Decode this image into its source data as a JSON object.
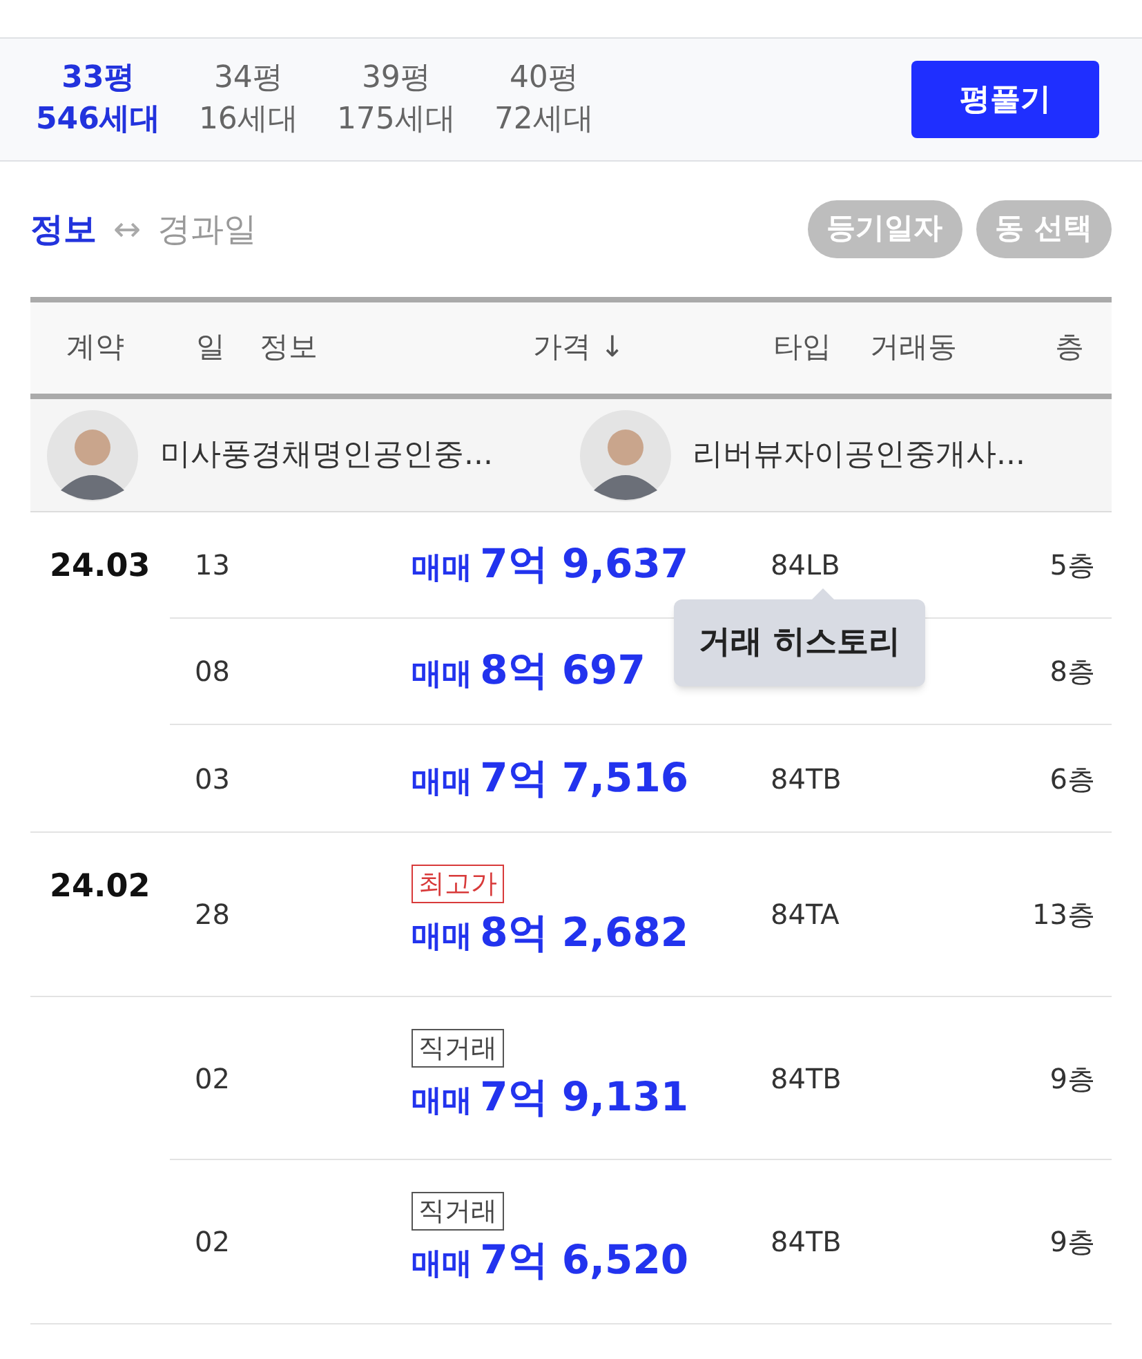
{
  "size_tabs": [
    {
      "area": "33평",
      "households": "546세대",
      "selected": true
    },
    {
      "area": "34평",
      "households": "16세대",
      "selected": false
    },
    {
      "area": "39평",
      "households": "175세대",
      "selected": false
    },
    {
      "area": "40평",
      "households": "72세대",
      "selected": false
    }
  ],
  "size_button": "평풀기",
  "view_toggle": {
    "options": [
      {
        "label": "정보",
        "selected": true
      },
      {
        "label": "경과일",
        "selected": false
      }
    ],
    "arrow": "↔"
  },
  "filter_buttons": [
    "등기일자",
    "동 선택"
  ],
  "table": {
    "columns": [
      "계약",
      "일",
      "정보",
      "가격 ↓",
      "타입",
      "거래동",
      "층"
    ],
    "agents": [
      {
        "name": "미사풍경채명인공인중...",
        "kind": "picture"
      },
      {
        "name": "리버뷰자이공인중개사...",
        "kind": "picture"
      }
    ],
    "groups": [
      {
        "date": "24.03",
        "trades": [
          {
            "day": "13",
            "deal": "매매",
            "price": "7억 9,637",
            "type": "84LB",
            "floor": "5층"
          },
          {
            "day": "08",
            "deal": "매매",
            "price": "8억 697",
            "floor": "8층"
          },
          {
            "day": "03",
            "deal": "매매",
            "price": "7억 7,516",
            "type": "84TB",
            "floor": "6층"
          }
        ]
      },
      {
        "date": "24.02",
        "trades": [
          {
            "day": "28",
            "tag": {
              "kind": "highest",
              "label": "최고가"
            },
            "deal": "매매",
            "price": "8억 2,682",
            "type": "84TA",
            "floor": "13층"
          }
        ]
      },
      {
        "trades": [
          {
            "day": "02",
            "tag": {
              "kind": "direct",
              "label": "직거래"
            },
            "deal": "매매",
            "price": "7억 9,131",
            "type": "84TB",
            "floor": "9층"
          },
          {
            "day": "02",
            "tag": {
              "kind": "direct",
              "label": "직거래"
            },
            "deal": "매매",
            "price": "7억 6,520",
            "type": "84TB",
            "floor": "9층"
          }
        ]
      }
    ]
  },
  "tooltip": "거래 히스토리"
}
